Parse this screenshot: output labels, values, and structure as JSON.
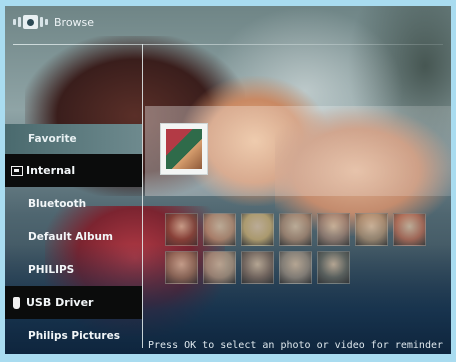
{
  "header": {
    "title": "Browse",
    "icon": "browse-icon"
  },
  "menu": {
    "items": [
      {
        "label": "Favorite",
        "state": "highlighted"
      },
      {
        "label": "Internal",
        "state": "selected",
        "icon": "internal-memory-icon"
      },
      {
        "label": "Bluetooth"
      },
      {
        "label": "Default Album"
      },
      {
        "label": "PHILIPS"
      },
      {
        "label": "USB Driver",
        "state": "selected",
        "icon": "usb-icon"
      },
      {
        "label": "Philips Pictures"
      }
    ]
  },
  "photos": {
    "thumbnails": [
      {
        "color": "#8a4a3a"
      },
      {
        "color": "#c49070"
      },
      {
        "color": "#d0b070"
      },
      {
        "color": "#b08a70"
      },
      {
        "color": "#a08070"
      },
      {
        "color": "#b09070"
      },
      {
        "color": "#c06a50"
      },
      {
        "color": "#9a7a60"
      },
      {
        "color": "#b89a80"
      },
      {
        "color": "#8a7060"
      },
      {
        "color": "#a09080"
      },
      {
        "color": "#6a6a60"
      }
    ]
  },
  "status": {
    "hint": "Press OK to select an photo or video for reminder"
  }
}
